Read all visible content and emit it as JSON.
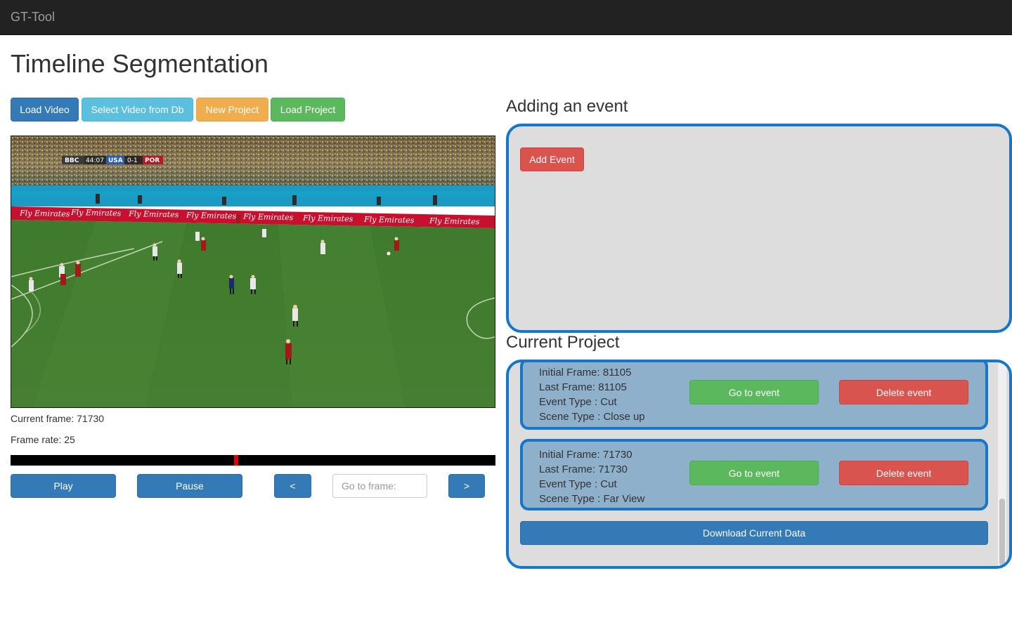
{
  "navbar": {
    "brand": "GT-Tool"
  },
  "page": {
    "title": "Timeline Segmentation"
  },
  "toolbar": {
    "load_video": "Load Video",
    "select_video": "Select Video from Db",
    "new_project": "New Project",
    "load_project": "Load Project"
  },
  "video": {
    "scorebug": {
      "channel": "BBC",
      "clock": "44:07",
      "home": "USA",
      "score": "0-1",
      "away": "POR"
    },
    "board_text": "Fly Emirates"
  },
  "player_info": {
    "current_frame": "Current frame: 71730",
    "frame_rate": "Frame rate: 25",
    "timeline_position": 0.465
  },
  "controls": {
    "play": "Play",
    "pause": "Pause",
    "prev": "<",
    "next": ">",
    "goto_placeholder": "Go to frame:"
  },
  "adding_event": {
    "title": "Adding an event",
    "add_button": "Add Event"
  },
  "current_project": {
    "title": "Current Project",
    "events": [
      {
        "initial": "Initial Frame: 81105",
        "last": "Last Frame: 81105",
        "event_type": "Event Type : Cut",
        "scene_type": "Scene Type : Close up",
        "goto_label": "Go to event",
        "delete_label": "Delete event"
      },
      {
        "initial": "Initial Frame: 71730",
        "last": "Last Frame: 71730",
        "event_type": "Event Type : Cut",
        "scene_type": "Scene Type : Far View",
        "goto_label": "Go to event",
        "delete_label": "Delete event"
      }
    ],
    "download_label": "Download Current Data"
  },
  "colors": {
    "panel_border": "#1477c9",
    "panel_bg": "#dddddd",
    "card_bg": "#8eb0cb",
    "timeline_marker": "#e00000"
  }
}
